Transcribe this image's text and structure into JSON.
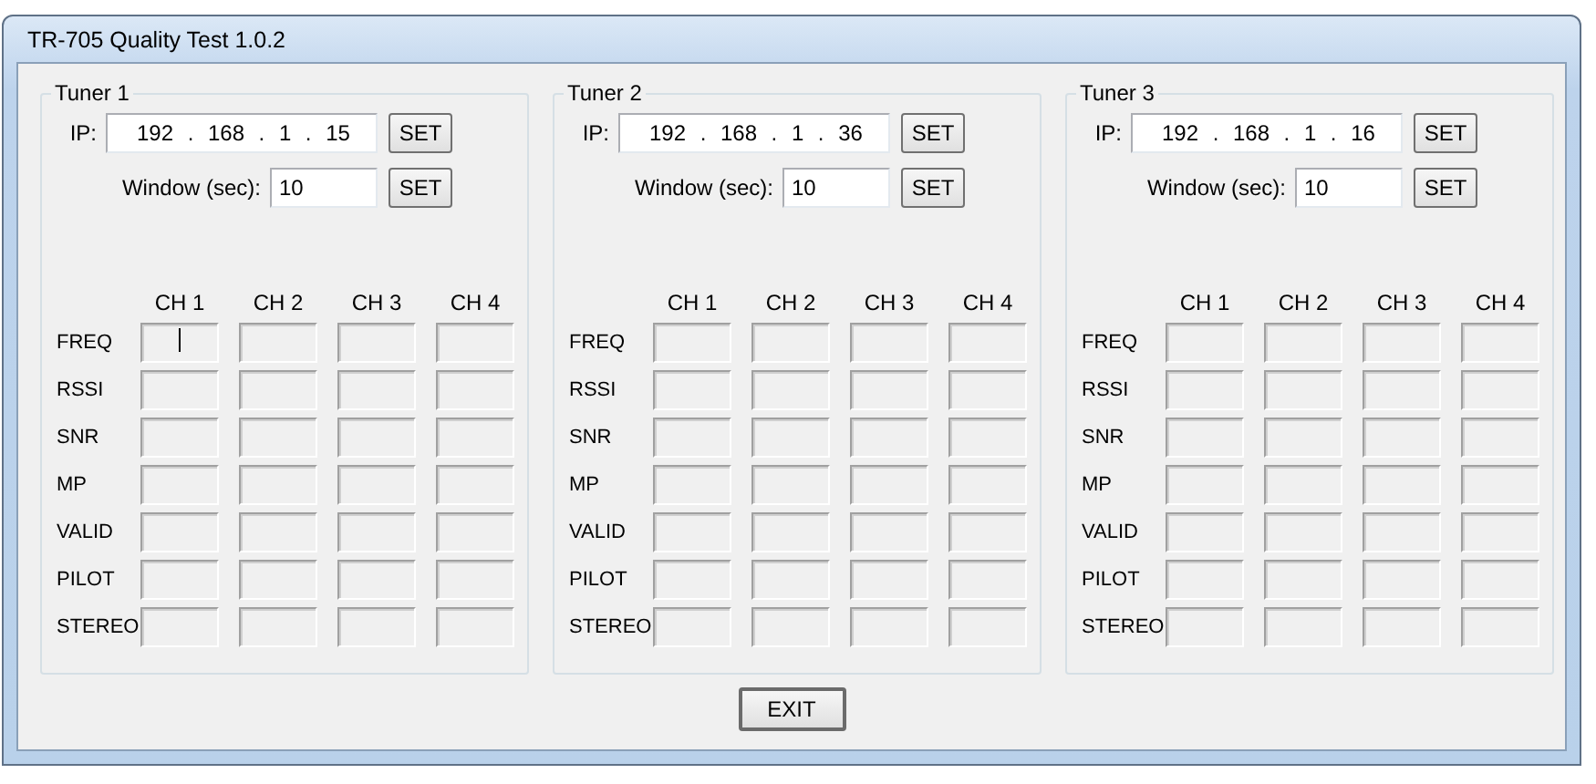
{
  "window": {
    "title": "TR-705 Quality Test 1.0.2"
  },
  "tuners": [
    {
      "title": "Tuner 1",
      "ip": {
        "label": "IP:",
        "parts": [
          "192",
          ".",
          "168",
          ".",
          "1",
          ".",
          "15"
        ],
        "button": "SET"
      },
      "window_sec": {
        "label": "Window (sec):",
        "value": "10",
        "button": "SET"
      },
      "channels": [
        "CH 1",
        "CH 2",
        "CH 3",
        "CH 4"
      ],
      "rows": [
        {
          "label": "FREQ",
          "cells": [
            {
              "focused": true
            },
            {
              "focused": false
            },
            {
              "focused": false
            },
            {
              "focused": false
            }
          ]
        },
        {
          "label": "RSSI",
          "cells": [
            {
              "focused": false
            },
            {
              "focused": false
            },
            {
              "focused": false
            },
            {
              "focused": false
            }
          ]
        },
        {
          "label": "SNR",
          "cells": [
            {
              "focused": false
            },
            {
              "focused": false
            },
            {
              "focused": false
            },
            {
              "focused": false
            }
          ]
        },
        {
          "label": "MP",
          "cells": [
            {
              "focused": false
            },
            {
              "focused": false
            },
            {
              "focused": false
            },
            {
              "focused": false
            }
          ]
        },
        {
          "label": "VALID",
          "cells": [
            {
              "focused": false
            },
            {
              "focused": false
            },
            {
              "focused": false
            },
            {
              "focused": false
            }
          ]
        },
        {
          "label": "PILOT",
          "cells": [
            {
              "focused": false
            },
            {
              "focused": false
            },
            {
              "focused": false
            },
            {
              "focused": false
            }
          ]
        },
        {
          "label": "STEREO",
          "cells": [
            {
              "focused": false
            },
            {
              "focused": false
            },
            {
              "focused": false
            },
            {
              "focused": false
            }
          ]
        }
      ]
    },
    {
      "title": "Tuner 2",
      "ip": {
        "label": "IP:",
        "parts": [
          "192",
          ".",
          "168",
          ".",
          "1",
          ".",
          "36"
        ],
        "button": "SET"
      },
      "window_sec": {
        "label": "Window (sec):",
        "value": "10",
        "button": "SET"
      },
      "channels": [
        "CH 1",
        "CH 2",
        "CH 3",
        "CH 4"
      ],
      "rows": [
        {
          "label": "FREQ",
          "cells": [
            {
              "focused": false
            },
            {
              "focused": false
            },
            {
              "focused": false
            },
            {
              "focused": false
            }
          ]
        },
        {
          "label": "RSSI",
          "cells": [
            {
              "focused": false
            },
            {
              "focused": false
            },
            {
              "focused": false
            },
            {
              "focused": false
            }
          ]
        },
        {
          "label": "SNR",
          "cells": [
            {
              "focused": false
            },
            {
              "focused": false
            },
            {
              "focused": false
            },
            {
              "focused": false
            }
          ]
        },
        {
          "label": "MP",
          "cells": [
            {
              "focused": false
            },
            {
              "focused": false
            },
            {
              "focused": false
            },
            {
              "focused": false
            }
          ]
        },
        {
          "label": "VALID",
          "cells": [
            {
              "focused": false
            },
            {
              "focused": false
            },
            {
              "focused": false
            },
            {
              "focused": false
            }
          ]
        },
        {
          "label": "PILOT",
          "cells": [
            {
              "focused": false
            },
            {
              "focused": false
            },
            {
              "focused": false
            },
            {
              "focused": false
            }
          ]
        },
        {
          "label": "STEREO",
          "cells": [
            {
              "focused": false
            },
            {
              "focused": false
            },
            {
              "focused": false
            },
            {
              "focused": false
            }
          ]
        }
      ]
    },
    {
      "title": "Tuner 3",
      "ip": {
        "label": "IP:",
        "parts": [
          "192",
          ".",
          "168",
          ".",
          "1",
          ".",
          "16"
        ],
        "button": "SET"
      },
      "window_sec": {
        "label": "Window (sec):",
        "value": "10",
        "button": "SET"
      },
      "channels": [
        "CH 1",
        "CH 2",
        "CH 3",
        "CH 4"
      ],
      "rows": [
        {
          "label": "FREQ",
          "cells": [
            {
              "focused": false
            },
            {
              "focused": false
            },
            {
              "focused": false
            },
            {
              "focused": false
            }
          ]
        },
        {
          "label": "RSSI",
          "cells": [
            {
              "focused": false
            },
            {
              "focused": false
            },
            {
              "focused": false
            },
            {
              "focused": false
            }
          ]
        },
        {
          "label": "SNR",
          "cells": [
            {
              "focused": false
            },
            {
              "focused": false
            },
            {
              "focused": false
            },
            {
              "focused": false
            }
          ]
        },
        {
          "label": "MP",
          "cells": [
            {
              "focused": false
            },
            {
              "focused": false
            },
            {
              "focused": false
            },
            {
              "focused": false
            }
          ]
        },
        {
          "label": "VALID",
          "cells": [
            {
              "focused": false
            },
            {
              "focused": false
            },
            {
              "focused": false
            },
            {
              "focused": false
            }
          ]
        },
        {
          "label": "PILOT",
          "cells": [
            {
              "focused": false
            },
            {
              "focused": false
            },
            {
              "focused": false
            },
            {
              "focused": false
            }
          ]
        },
        {
          "label": "STEREO",
          "cells": [
            {
              "focused": false
            },
            {
              "focused": false
            },
            {
              "focused": false
            },
            {
              "focused": false
            }
          ]
        }
      ]
    }
  ],
  "exit_button": "EXIT"
}
